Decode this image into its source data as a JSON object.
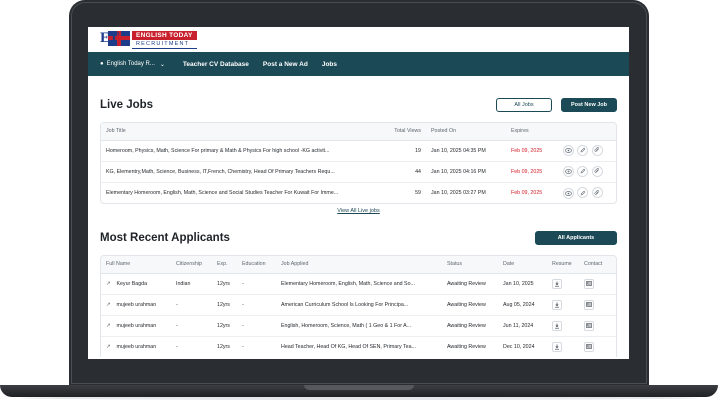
{
  "logo": {
    "mark": "ET",
    "line1": "ENGLISH TODAY",
    "line2": "RECRUITMENT"
  },
  "nav": {
    "dropdown_label": "English Today R...",
    "links": [
      "Teacher CV Database",
      "Post a New Ad",
      "Jobs"
    ]
  },
  "live_jobs": {
    "title": "Live Jobs",
    "all_jobs_label": "All Jobs",
    "post_new_job_label": "Post New Job",
    "columns": [
      "Job Title",
      "Total Views",
      "Posted On",
      "Expires"
    ],
    "rows": [
      {
        "title": "Homeroom, Physics, Math, Science For primary &  Math & Physics For high school -KG activit...",
        "views": "19",
        "posted": "Jan 10, 2025 04:35 PM",
        "expires": "Feb 09, 2025"
      },
      {
        "title": "KG, Elementry,Math, Science, Business, IT,French, Chemistry, Head Of Primary Teachers Requ...",
        "views": "44",
        "posted": "Jan 10, 2025 04:16 PM",
        "expires": "Feb 09, 2025"
      },
      {
        "title": "Elementary Homeroom, English, Math, Science and Social Studies Teacher For Kuwait For Imme...",
        "views": "59",
        "posted": "Jan 10, 2025 03:27 PM",
        "expires": "Feb 09, 2025"
      }
    ],
    "view_all_label": "View All Live jobs"
  },
  "applicants": {
    "title": "Most Recent Applicants",
    "all_applicants_label": "All Applicants",
    "columns": [
      "Full Name",
      "Citizenship",
      "Exp.",
      "Education",
      "Job Applied",
      "Status",
      "Date",
      "Resume",
      "Contact"
    ],
    "rows": [
      {
        "name": "Keyur Bagda",
        "citizenship": "Indian",
        "exp": "12yrs",
        "education": "-",
        "job": "Elementary Homeroom, English, Math, Science and So...",
        "status": "Awaiting Review",
        "date": "Jan 10, 2025"
      },
      {
        "name": "mujeeb urahman",
        "citizenship": "-",
        "exp": "12yrs",
        "education": "-",
        "job": "American Curriculum School Is Looking For Principa...",
        "status": "Awaiting Review",
        "date": "Aug 05, 2024"
      },
      {
        "name": "mujeeb urahman",
        "citizenship": "-",
        "exp": "12yrs",
        "education": "-",
        "job": "English, Homeroom, Science, Math ( 1 Geo & 1 For A...",
        "status": "Awaiting Review",
        "date": "Jun 11, 2024"
      },
      {
        "name": "mujeeb urahman",
        "citizenship": "-",
        "exp": "12yrs",
        "education": "-",
        "job": "Head Teacher, Head Of KG, Head Of SEN, Primary Tea...",
        "status": "Awaiting Review",
        "date": "Dec 10, 2024"
      }
    ]
  },
  "colors": {
    "nav_bg": "#1b4955",
    "expires_red": "#d21f2a",
    "laptop_frame": "#2a2d31"
  }
}
